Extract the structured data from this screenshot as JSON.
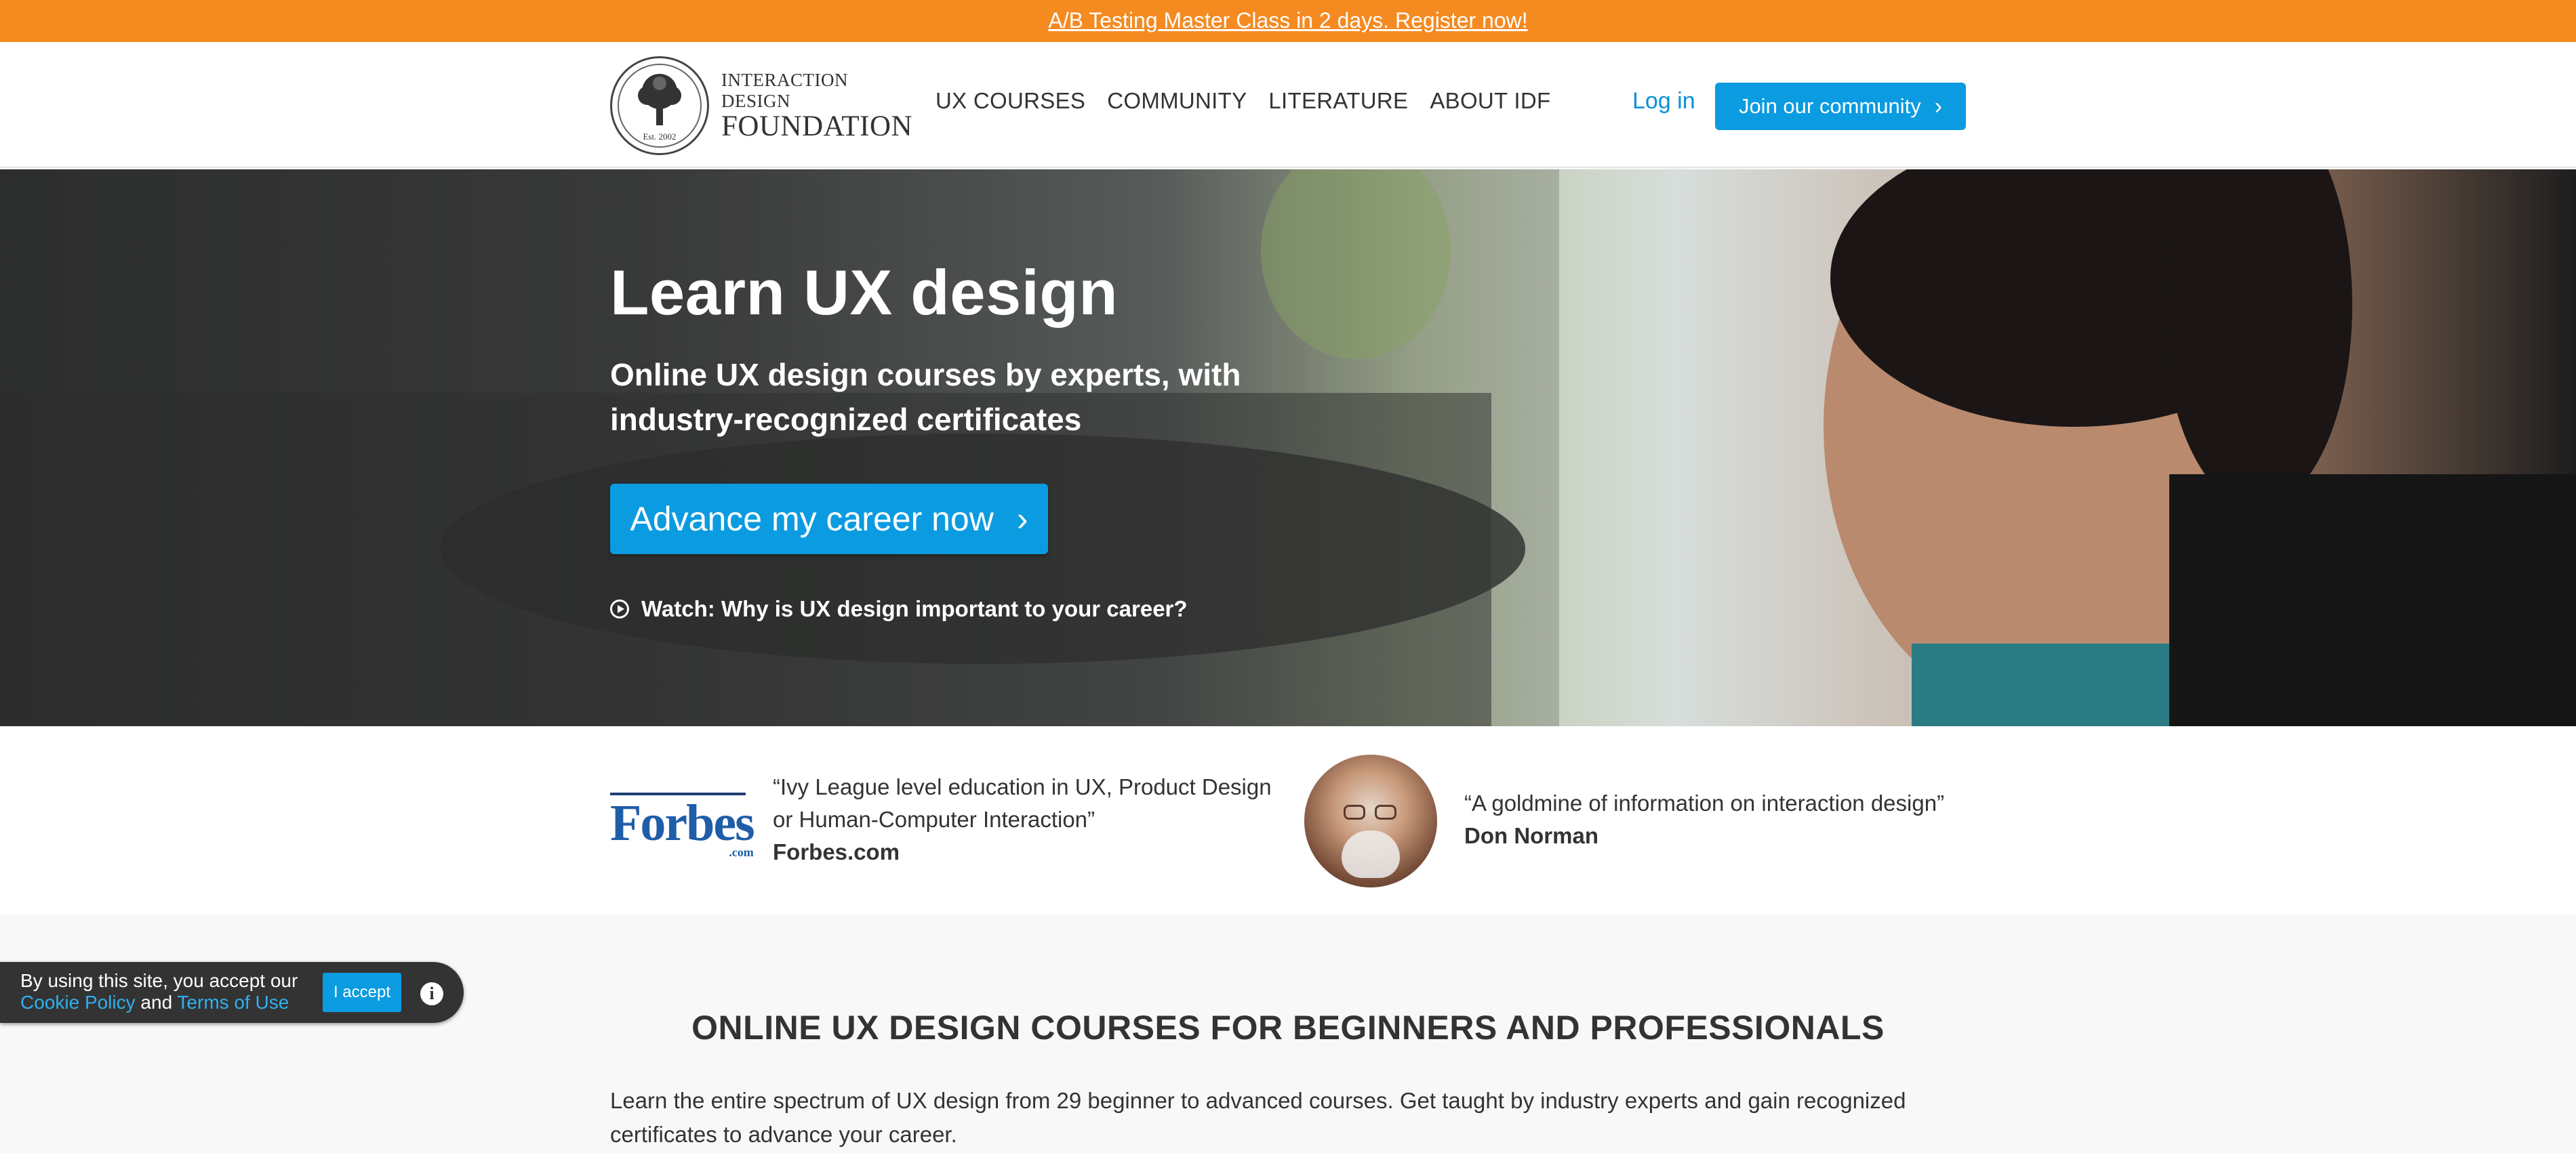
{
  "promo": {
    "text": "A/B Testing Master Class in 2 days. Register now!"
  },
  "header": {
    "logo": {
      "line1": "INTERACTION DESIGN",
      "line2": "FOUNDATION",
      "seal_est": "Est. 2002"
    },
    "nav": [
      {
        "label": "UX COURSES"
      },
      {
        "label": "COMMUNITY"
      },
      {
        "label": "LITERATURE"
      },
      {
        "label": "ABOUT IDF"
      }
    ],
    "login_label": "Log in",
    "join_label": "Join our community"
  },
  "hero": {
    "title": "Learn UX design",
    "subtitle": "Online UX design courses by experts, with industry-recognized certificates",
    "cta_label": "Advance my career now",
    "watch_label": "Watch: Why is UX design important to your career?"
  },
  "testimonials": [
    {
      "logo": "Forbes",
      "logo_suffix": ".com",
      "quote": "“Ivy League level education in UX, Product Design or Human-Computer Interaction”",
      "source": "Forbes.com"
    },
    {
      "quote": "“A goldmine of information on interaction design”",
      "source": "Don Norman"
    }
  ],
  "cookie": {
    "text": "By using this site, you accept our",
    "cookie_policy": "Cookie Policy",
    "and": "and",
    "terms": "Terms of Use",
    "accept_label": "I accept"
  },
  "courses": {
    "title": "ONLINE UX DESIGN COURSES FOR BEGINNERS AND PROFESSIONALS",
    "body": "Learn the entire spectrum of UX design from 29 beginner to advanced courses. Get taught by industry experts and gain recognized certificates to advance your career."
  },
  "colors": {
    "promo": "#f58a21",
    "accent": "#0b9be0",
    "link": "#0b8fd6",
    "cookie_bg": "#333333"
  }
}
